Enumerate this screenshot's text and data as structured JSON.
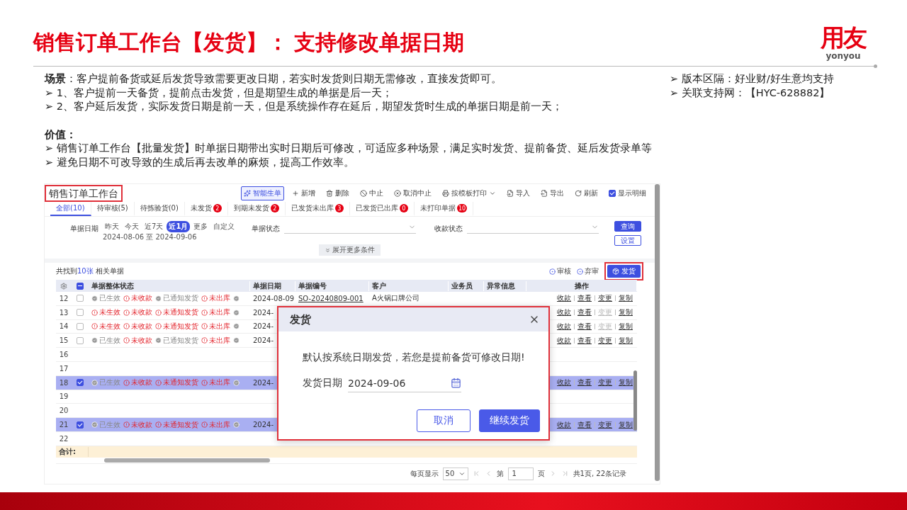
{
  "slide": {
    "title": "销售订单工作台【发货】： 支持修改单据日期",
    "logo": {
      "mark": "用友",
      "wordmark": "yonyou"
    }
  },
  "intro": {
    "scenario": "**场景**：客户提前备货或延后发货导致需要更改日期，若实时发货则日期无需修改，直接发货即可。",
    "scenario_points": [
      "➢ 1、客户提前一天备货，提前点击发货，但是期望生成的单据是后一天；",
      "➢ 2、客户延后发货，实际发货日期是前一天，但是系统操作存在延后，期望发货时生成的单据日期是前一天；"
    ],
    "value_heading": "价值：",
    "value_points": [
      "➢ 销售订单工作台【批量发货】时单据日期带出实时日期后可修改，可适应多种场景，满足实时发货、提前备货、延后发货录单等",
      "➢ 避免日期不可改导致的生成后再去改单的麻烦，提高工作效率。"
    ],
    "notes": [
      "➢ 版本区隔：好业财/好生意均支持",
      "➢ 关联支持网：【HYC-628882】"
    ]
  },
  "app": {
    "title": "销售订单工作台",
    "toolbar": [
      {
        "label": "智能生单",
        "kind": "outlined"
      },
      {
        "label": "新增",
        "kind": "plain"
      },
      {
        "label": "删除",
        "kind": "plain"
      },
      {
        "label": "中止",
        "kind": "plain"
      },
      {
        "label": "取消中止",
        "kind": "plain"
      },
      {
        "label": "按模板打印",
        "kind": "menu"
      },
      {
        "label": "导入",
        "kind": "plain"
      },
      {
        "label": "导出",
        "kind": "plain"
      },
      {
        "label": "刷新",
        "kind": "plain"
      },
      {
        "label": "显示明细",
        "kind": "checkbox",
        "checked": true
      }
    ],
    "tabs": [
      {
        "label": "全部(10)",
        "selected": true
      },
      {
        "label": "待审核(5)",
        "selected": false
      },
      {
        "label": "待拣验货(0)",
        "selected": false
      },
      {
        "label": "未发货",
        "badge": "2",
        "selected": false
      },
      {
        "label": "到期未发货",
        "badge": "2",
        "selected": false
      },
      {
        "label": "已发货未出库",
        "badge": "3",
        "selected": false
      },
      {
        "label": "已发货已出库",
        "badge": "0",
        "selected": false
      },
      {
        "label": "未打印单据",
        "badge": "10",
        "selected": false
      }
    ],
    "filters": {
      "date": {
        "label": "单据日期",
        "options": [
          {
            "label": "昨天",
            "selected": false
          },
          {
            "label": "今天",
            "selected": false
          },
          {
            "label": "近7天",
            "selected": false
          },
          {
            "label": "近1月",
            "selected": true
          },
          {
            "label": "更多",
            "selected": false
          },
          {
            "label": "自定义",
            "selected": false
          }
        ],
        "range": "2024-08-06 至 2024-09-06"
      },
      "selects": [
        {
          "label": "单据状态"
        },
        {
          "label": "收款状态"
        }
      ],
      "buttons": [
        {
          "label": "查询",
          "kind": "primary"
        },
        {
          "label": "设置",
          "kind": "outline"
        }
      ],
      "expand": "展开更多条件"
    },
    "summary": {
      "prefix": "共找到",
      "count": "10张",
      "suffix": " 相关单据",
      "actions": [
        "审核",
        "弃审"
      ],
      "ship_button": "发货"
    },
    "table": {
      "select_all_mixed": true,
      "columns": [
        "单据整体状态",
        "单据日期",
        "单据编号",
        "客户",
        "业务员",
        "异常信息",
        "操作"
      ],
      "rows": [
        {
          "index": "12",
          "checked": false,
          "selected": false,
          "statuses": [
            {
              "label": "已生效",
              "ok": true
            },
            {
              "label": "未收款",
              "ok": false
            },
            {
              "label": "已通知发货",
              "ok": true
            },
            {
              "label": "未出库",
              "ok": false
            }
          ],
          "date": "2024-08-09",
          "number": "SO-20240809-001",
          "customer": "A火锅口牌公司",
          "actions": [
            {
              "label": "收款",
              "disabled": false
            },
            {
              "label": "查看",
              "disabled": false
            },
            {
              "label": "变更",
              "disabled": false
            },
            {
              "label": "复制",
              "disabled": false
            }
          ]
        },
        {
          "index": "13",
          "checked": false,
          "selected": false,
          "statuses": [
            {
              "label": "未生效",
              "ok": false
            },
            {
              "label": "未收款",
              "ok": false
            },
            {
              "label": "未通知发货",
              "ok": false
            },
            {
              "label": "未出库",
              "ok": false
            }
          ],
          "date": "2024-",
          "actions": [
            {
              "label": "收款",
              "disabled": false
            },
            {
              "label": "查看",
              "disabled": false
            },
            {
              "label": "变更",
              "disabled": true
            },
            {
              "label": "复制",
              "disabled": false
            }
          ]
        },
        {
          "index": "14",
          "checked": false,
          "selected": false,
          "statuses": [
            {
              "label": "未生效",
              "ok": false
            },
            {
              "label": "未收款",
              "ok": false
            },
            {
              "label": "未通知发货",
              "ok": false
            },
            {
              "label": "未出库",
              "ok": false
            }
          ],
          "date": "2024-",
          "actions": [
            {
              "label": "收款",
              "disabled": false
            },
            {
              "label": "查看",
              "disabled": false
            },
            {
              "label": "变更",
              "disabled": true
            },
            {
              "label": "复制",
              "disabled": false
            }
          ]
        },
        {
          "index": "15",
          "checked": false,
          "selected": false,
          "statuses": [
            {
              "label": "已生效",
              "ok": true
            },
            {
              "label": "未收款",
              "ok": false
            },
            {
              "label": "已通知发货",
              "ok": true
            },
            {
              "label": "未出库",
              "ok": false
            }
          ],
          "date": "2024-",
          "actions": [
            {
              "label": "收款",
              "disabled": false
            },
            {
              "label": "查看",
              "disabled": false
            },
            {
              "label": "变更",
              "disabled": false
            },
            {
              "label": "复制",
              "disabled": false
            }
          ]
        },
        {
          "index": "16",
          "selected": false
        },
        {
          "index": "17",
          "selected": false
        },
        {
          "index": "18",
          "checked": true,
          "selected": true,
          "statuses": [
            {
              "label": "已生效",
              "ok": true
            },
            {
              "label": "未收款",
              "ok": false
            },
            {
              "label": "未通知发货",
              "ok": false
            },
            {
              "label": "未出库",
              "ok": false
            }
          ],
          "date": "2024-",
          "actions": [
            {
              "label": "收款",
              "disabled": false
            },
            {
              "label": "查看",
              "disabled": false
            },
            {
              "label": "变更",
              "disabled": false
            },
            {
              "label": "复制",
              "disabled": false
            }
          ]
        },
        {
          "index": "19",
          "selected": false
        },
        {
          "index": "20",
          "selected": false
        },
        {
          "index": "21",
          "checked": true,
          "selected": true,
          "statuses": [
            {
              "label": "已生效",
              "ok": true
            },
            {
              "label": "未收款",
              "ok": false
            },
            {
              "label": "未通知发货",
              "ok": false
            },
            {
              "label": "未出库",
              "ok": false
            }
          ],
          "date": "2024-",
          "actions": [
            {
              "label": "收款",
              "disabled": false
            },
            {
              "label": "查看",
              "disabled": false
            },
            {
              "label": "变更",
              "disabled": false
            },
            {
              "label": "复制",
              "disabled": false
            }
          ]
        },
        {
          "index": "22",
          "selected": false
        }
      ],
      "total_label": "合计:"
    },
    "pagination": {
      "per_page_label": "每页显示",
      "per_page": "50",
      "page_prefix": "第",
      "page": "1",
      "page_suffix": "页",
      "summary": "共1页, 22条记录"
    },
    "dialog": {
      "title": "发货",
      "message": "默认按系统日期发货，若您是提前备货可修改日期!",
      "date_label": "发货日期",
      "date_value": "2024-09-06",
      "buttons": [
        {
          "label": "取消",
          "kind": "secondary"
        },
        {
          "label": "继续发货",
          "kind": "primary"
        }
      ]
    }
  }
}
